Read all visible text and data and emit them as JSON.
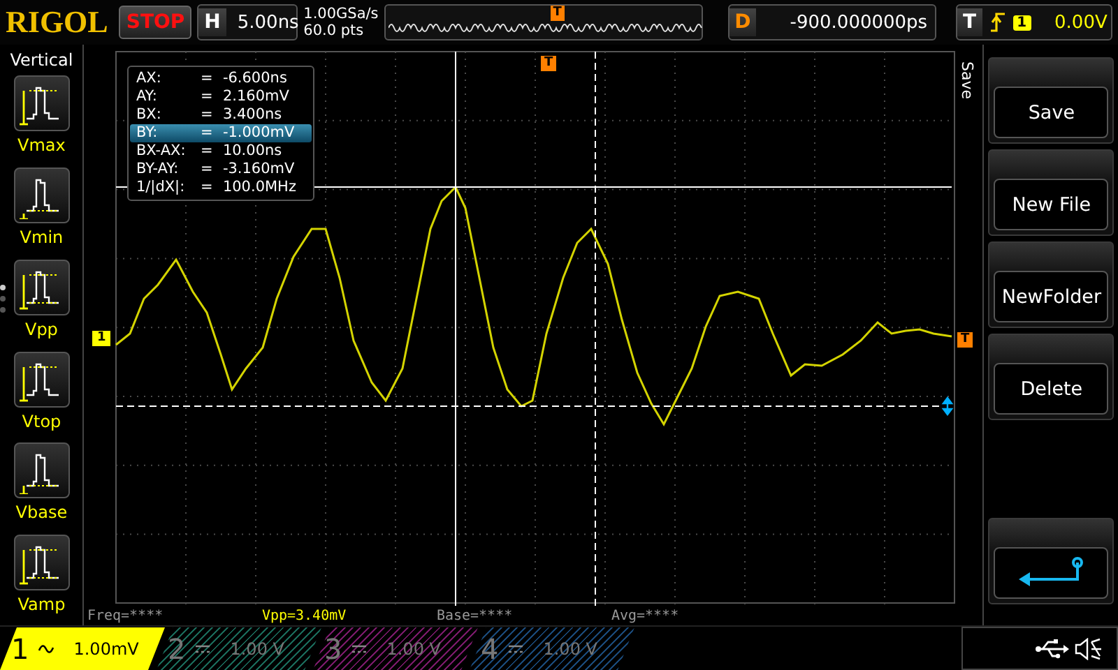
{
  "brand": "RIGOL",
  "run_state": {
    "label": "STOP",
    "running": false
  },
  "horizontal": {
    "label": "H",
    "timebase": "5.00ns",
    "sample_rate": "1.00GSa/s",
    "memory_depth": "60.0 pts",
    "trigger_marker": "T"
  },
  "delay": {
    "label": "D",
    "value": "-900.000000ps"
  },
  "trigger": {
    "label": "T",
    "source": "1",
    "trigger_level": "0.00V"
  },
  "sidebar": {
    "title": "Vertical",
    "items": [
      {
        "label": "Vmax",
        "kind": "vmax"
      },
      {
        "label": "Vmin",
        "kind": "vmin"
      },
      {
        "label": "Vpp",
        "kind": "vpp"
      },
      {
        "label": "Vtop",
        "kind": "vtop"
      },
      {
        "label": "Vbase",
        "kind": "vbase"
      },
      {
        "label": "Vamp",
        "kind": "vamp"
      }
    ],
    "pages": [
      {
        "selected": true
      },
      {
        "selected": false
      },
      {
        "selected": false
      }
    ]
  },
  "screen": {
    "trigger_position_marker": "T",
    "channel_marker": "1",
    "trigger_level_marker": "T",
    "cursor_readout": [
      {
        "name": "AX:",
        "equals": "=",
        "value": "-6.600ns",
        "selected": false
      },
      {
        "name": "AY:",
        "equals": "=",
        "value": "2.160mV",
        "selected": false
      },
      {
        "name": "BX:",
        "equals": "=",
        "value": "3.400ns",
        "selected": false
      },
      {
        "name": "BY:",
        "equals": "=",
        "value": "-1.000mV",
        "selected": true
      },
      {
        "name": "BX-AX:",
        "equals": "=",
        "value": "10.00ns",
        "selected": false
      },
      {
        "name": "BY-AY:",
        "equals": "=",
        "value": "-3.160mV",
        "selected": false
      },
      {
        "name": "1/|dX|:",
        "equals": "=",
        "value": "100.0MHz",
        "selected": false
      }
    ]
  },
  "measurements": [
    {
      "text": "Freq=****",
      "active": false
    },
    {
      "text": "Vpp=3.40mV",
      "active": true
    },
    {
      "text": "Base=****",
      "active": false
    },
    {
      "text": "Avg=****",
      "active": false
    }
  ],
  "menu": {
    "title": "Save",
    "buttons": [
      {
        "label": "Save",
        "kind": "text"
      },
      {
        "label": "New File",
        "kind": "text"
      },
      {
        "label": "NewFolder",
        "kind": "text"
      },
      {
        "label": "Delete",
        "kind": "text"
      },
      {
        "kind": "back"
      }
    ]
  },
  "channels": [
    {
      "number": "1",
      "kind": "ac",
      "scale": "1.00mV",
      "enabled": true,
      "color": "#ffff00"
    },
    {
      "number": "2",
      "kind": "dc",
      "scale": "1.00 V",
      "enabled": false,
      "color": "#1a6a5a"
    },
    {
      "number": "3",
      "kind": "dc",
      "scale": "1.00 V",
      "enabled": false,
      "color": "#7a1a6a"
    },
    {
      "number": "4",
      "kind": "dc",
      "scale": "1.00 V",
      "enabled": false,
      "color": "#1a4a7a"
    }
  ]
}
